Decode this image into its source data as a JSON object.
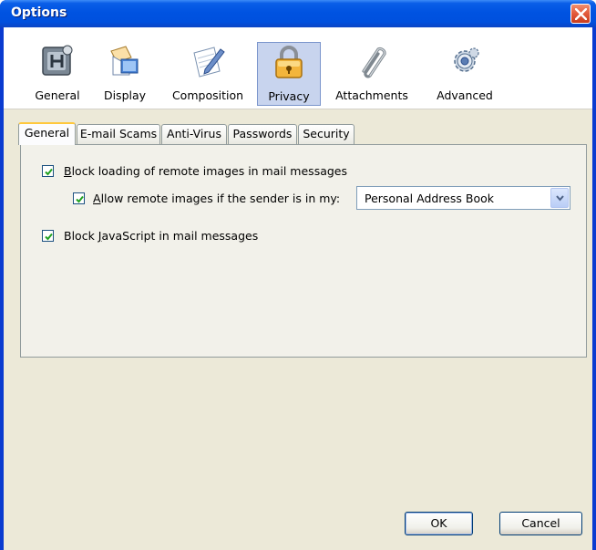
{
  "window": {
    "title": "Options"
  },
  "panes": [
    {
      "label": "General",
      "icon": "general-pane-icon",
      "selected": false
    },
    {
      "label": "Display",
      "icon": "display-pane-icon",
      "selected": false
    },
    {
      "label": "Composition",
      "icon": "composition-pane-icon",
      "selected": false
    },
    {
      "label": "Privacy",
      "icon": "padlock-icon",
      "selected": true
    },
    {
      "label": "Attachments",
      "icon": "paperclip-icon",
      "selected": false
    },
    {
      "label": "Advanced",
      "icon": "gears-icon",
      "selected": false
    }
  ],
  "tabs": [
    {
      "label": "General",
      "active": true
    },
    {
      "label": "E-mail Scams",
      "active": false
    },
    {
      "label": "Anti-Virus",
      "active": false
    },
    {
      "label": "Passwords",
      "active": false
    },
    {
      "label": "Security",
      "active": false
    }
  ],
  "general": {
    "block_images": {
      "key": "B",
      "rest": "lock loading of remote images in mail messages",
      "checked": true
    },
    "allow_remote": {
      "key": "A",
      "rest": "llow remote images if the sender is in my:",
      "checked": true
    },
    "address_book": {
      "value": "Personal Address Book"
    },
    "block_js": {
      "pre": "Block ",
      "key": "J",
      "rest": "avaScript in mail messages",
      "checked": true
    }
  },
  "buttons": {
    "ok": "OK",
    "cancel": "Cancel"
  },
  "colors": {
    "title_bar": "#0053e1",
    "dialog_face": "#ece9d8",
    "close_button": "#e2593a",
    "selected_pane": "#c8d4ee"
  }
}
